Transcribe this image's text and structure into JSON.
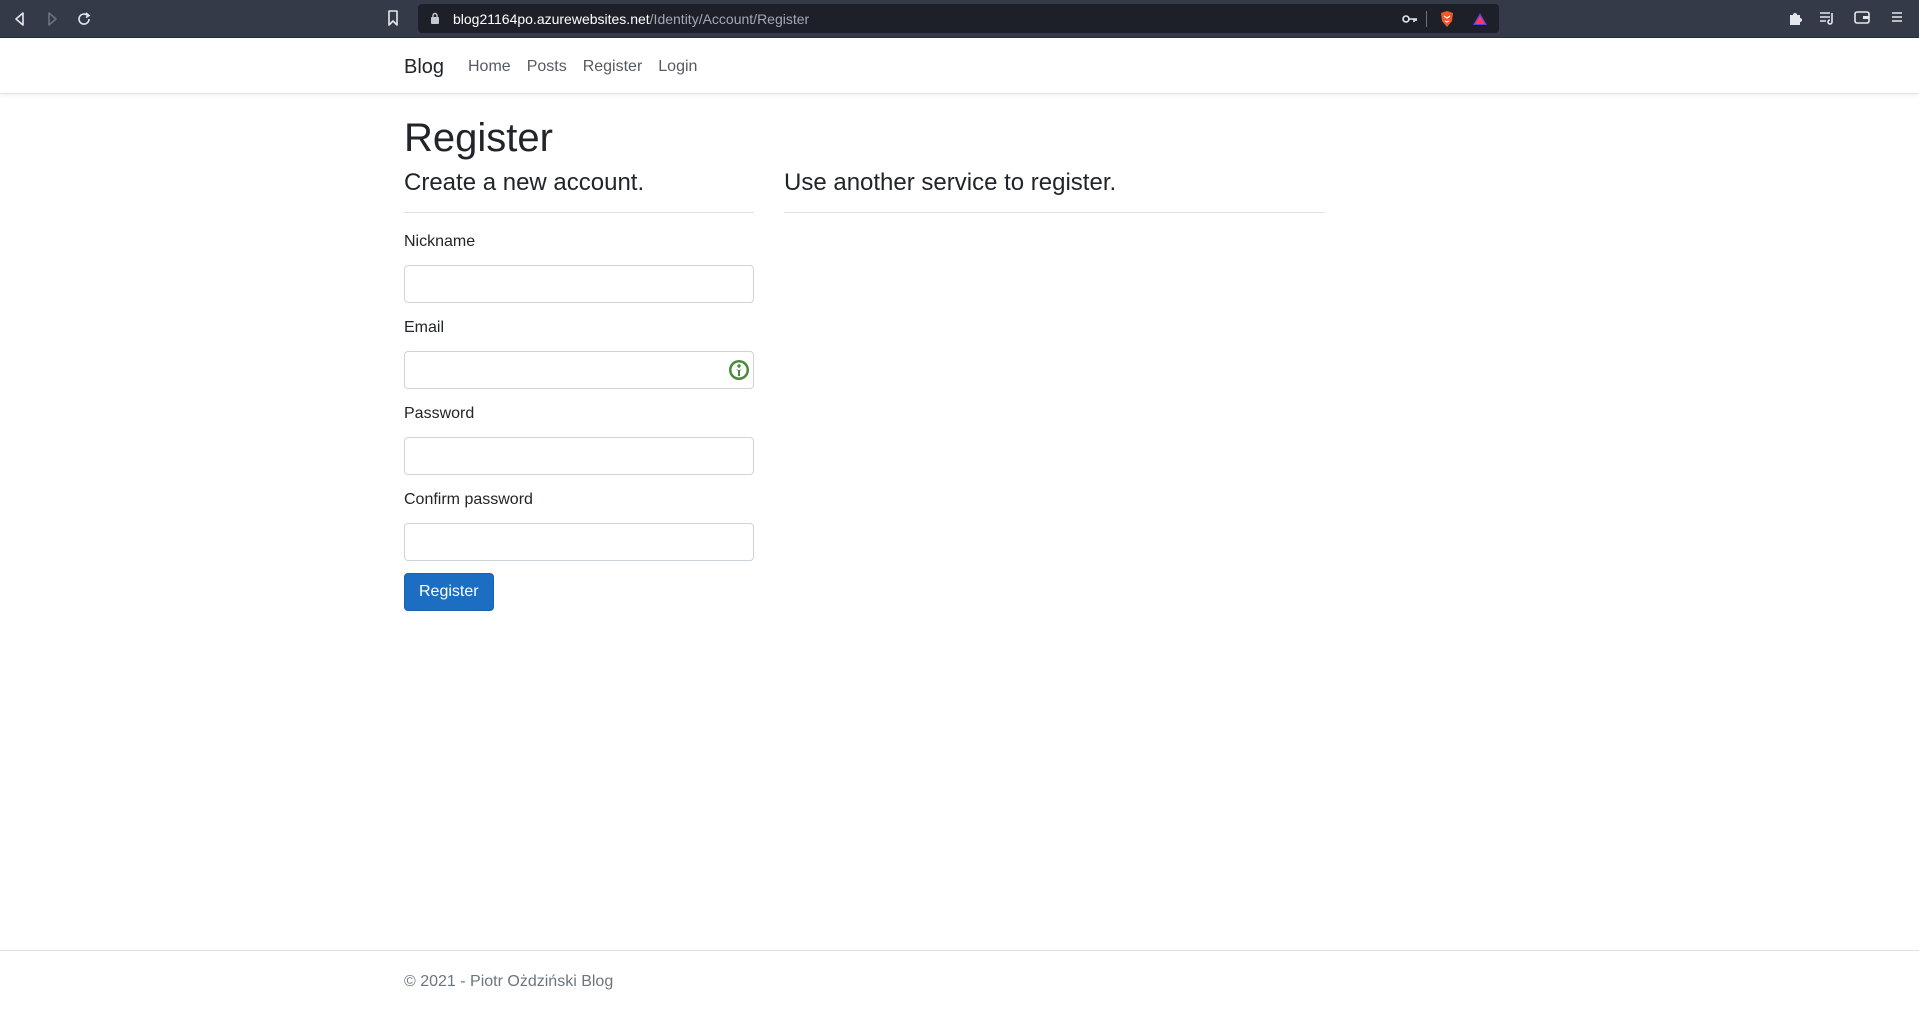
{
  "browser": {
    "url_host": "blog21164po.azurewebsites.net",
    "url_path": "/Identity/Account/Register",
    "icons": [
      "back-icon",
      "forward-icon",
      "reload-icon",
      "bookmark-icon",
      "lock-icon",
      "key-icon",
      "brave-shield-icon",
      "brave-rewards-icon",
      "extensions-icon",
      "playlist-icon",
      "wallet-icon",
      "menu-icon"
    ]
  },
  "navbar": {
    "brand": "Blog",
    "links": [
      {
        "label": "Home"
      },
      {
        "label": "Posts"
      },
      {
        "label": "Register"
      },
      {
        "label": "Login"
      }
    ]
  },
  "page": {
    "title": "Register",
    "left_heading": "Create a new account.",
    "right_heading": "Use another service to register."
  },
  "form": {
    "fields": [
      {
        "label": "Nickname",
        "value": ""
      },
      {
        "label": "Email",
        "value": ""
      },
      {
        "label": "Password",
        "value": ""
      },
      {
        "label": "Confirm password",
        "value": ""
      }
    ],
    "submit_label": "Register"
  },
  "footer": {
    "text": "© 2021 - Piotr Ożdziński Blog"
  },
  "colors": {
    "primary_button": "#1b6ec2",
    "browser_chrome": "#353a48"
  }
}
